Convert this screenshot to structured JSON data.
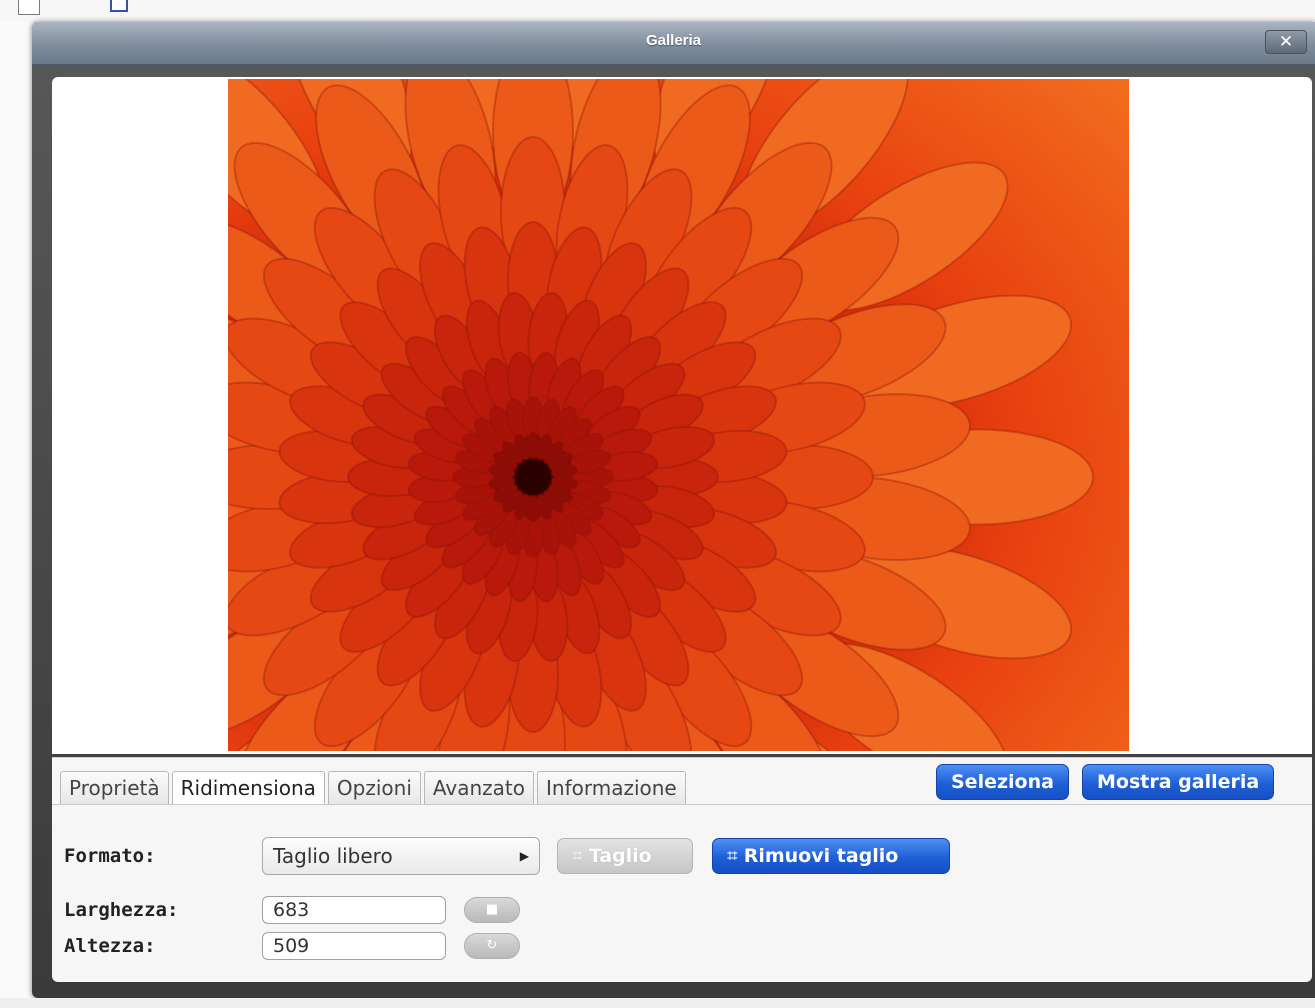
{
  "dialog": {
    "title": "Galleria",
    "close_label": "✕"
  },
  "preview": {
    "image_alt": "orange chrysanthemum flower"
  },
  "tabs": [
    {
      "label": "Proprietà",
      "active": false
    },
    {
      "label": "Ridimensiona",
      "active": true
    },
    {
      "label": "Opzioni",
      "active": false
    },
    {
      "label": "Avanzato",
      "active": false
    },
    {
      "label": "Informazione",
      "active": false
    }
  ],
  "actions": {
    "select_label": "Seleziona",
    "show_gallery_label": "Mostra galleria"
  },
  "resize": {
    "format_label": "Formato:",
    "format_value": "Taglio libero",
    "crop_label": "Taglio",
    "remove_crop_label": "Rimuovi taglio",
    "width_label": "Larghezza:",
    "width_value": "683",
    "height_label": "Altezza:",
    "height_value": "509"
  },
  "colors": {
    "accent": "#1e5fd6",
    "titlebar": "#8a97a6"
  },
  "icons": {
    "close": "close-icon",
    "crop": "crop-icon",
    "lock": "lock-icon",
    "reset": "reset-icon",
    "dropdown": "triangle-right-icon"
  }
}
